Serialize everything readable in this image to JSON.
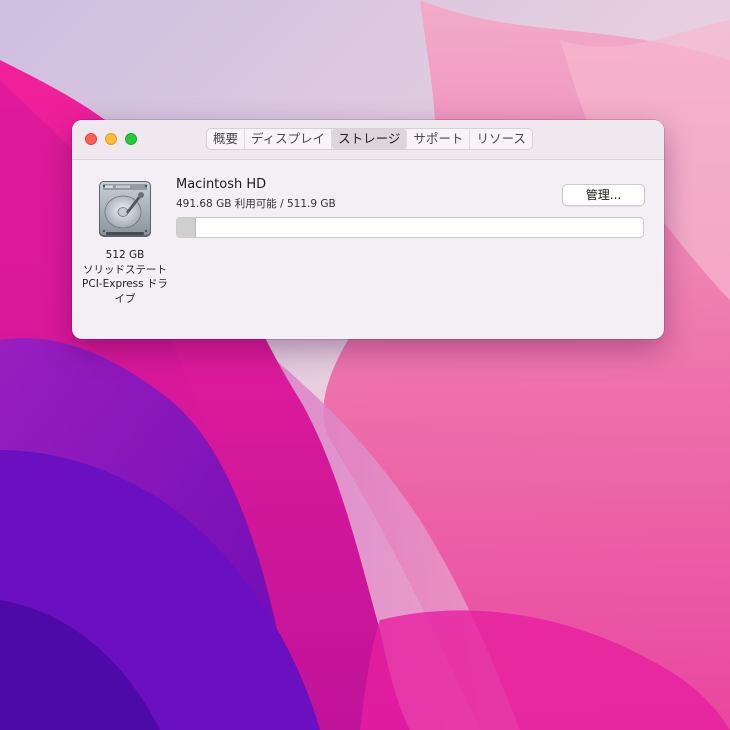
{
  "window": {
    "tabs": [
      {
        "label": "概要",
        "active": false
      },
      {
        "label": "ディスプレイ",
        "active": false
      },
      {
        "label": "ストレージ",
        "active": true
      },
      {
        "label": "サポート",
        "active": false
      },
      {
        "label": "リソース",
        "active": false
      }
    ]
  },
  "storage": {
    "drive": {
      "icon": "hard-drive-icon",
      "capacity_label": "512 GB",
      "type_line1": "ソリッドステート",
      "type_line2": "PCI-Express ドラ",
      "type_line3": "イブ"
    },
    "volume": {
      "name": "Macintosh HD",
      "info": "491.68 GB 利用可能 / 511.9 GB",
      "used_fraction": 0.04
    },
    "manage_label": "管理..."
  },
  "colors": {
    "close": "#fe5f57",
    "minimize": "#febc2e",
    "zoom": "#28c840",
    "window_bg": "#f4eff4",
    "usage_fill": "#cfcfcf"
  }
}
